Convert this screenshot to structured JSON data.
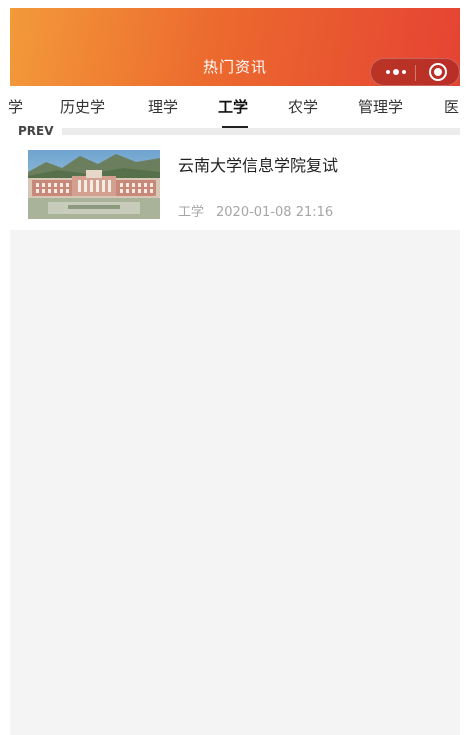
{
  "header": {
    "title": "热门资讯",
    "bg_colors": [
      "#f39a3a",
      "#ec6a2e",
      "#e54333"
    ],
    "more_icon": "more-dots-icon",
    "close_icon": "target-close-icon"
  },
  "tabs": [
    {
      "label": "学",
      "active": false
    },
    {
      "label": "历史学",
      "active": false
    },
    {
      "label": "理学",
      "active": false
    },
    {
      "label": "工学",
      "active": true
    },
    {
      "label": "农学",
      "active": false
    },
    {
      "label": "管理学",
      "active": false
    },
    {
      "label": "医",
      "active": false
    }
  ],
  "prev_label": "PREV",
  "news": [
    {
      "title": "云南大学信息学院复试",
      "category": "工学",
      "datetime": "2020-01-08 21:16",
      "thumbnail": "university-campus-image"
    }
  ]
}
